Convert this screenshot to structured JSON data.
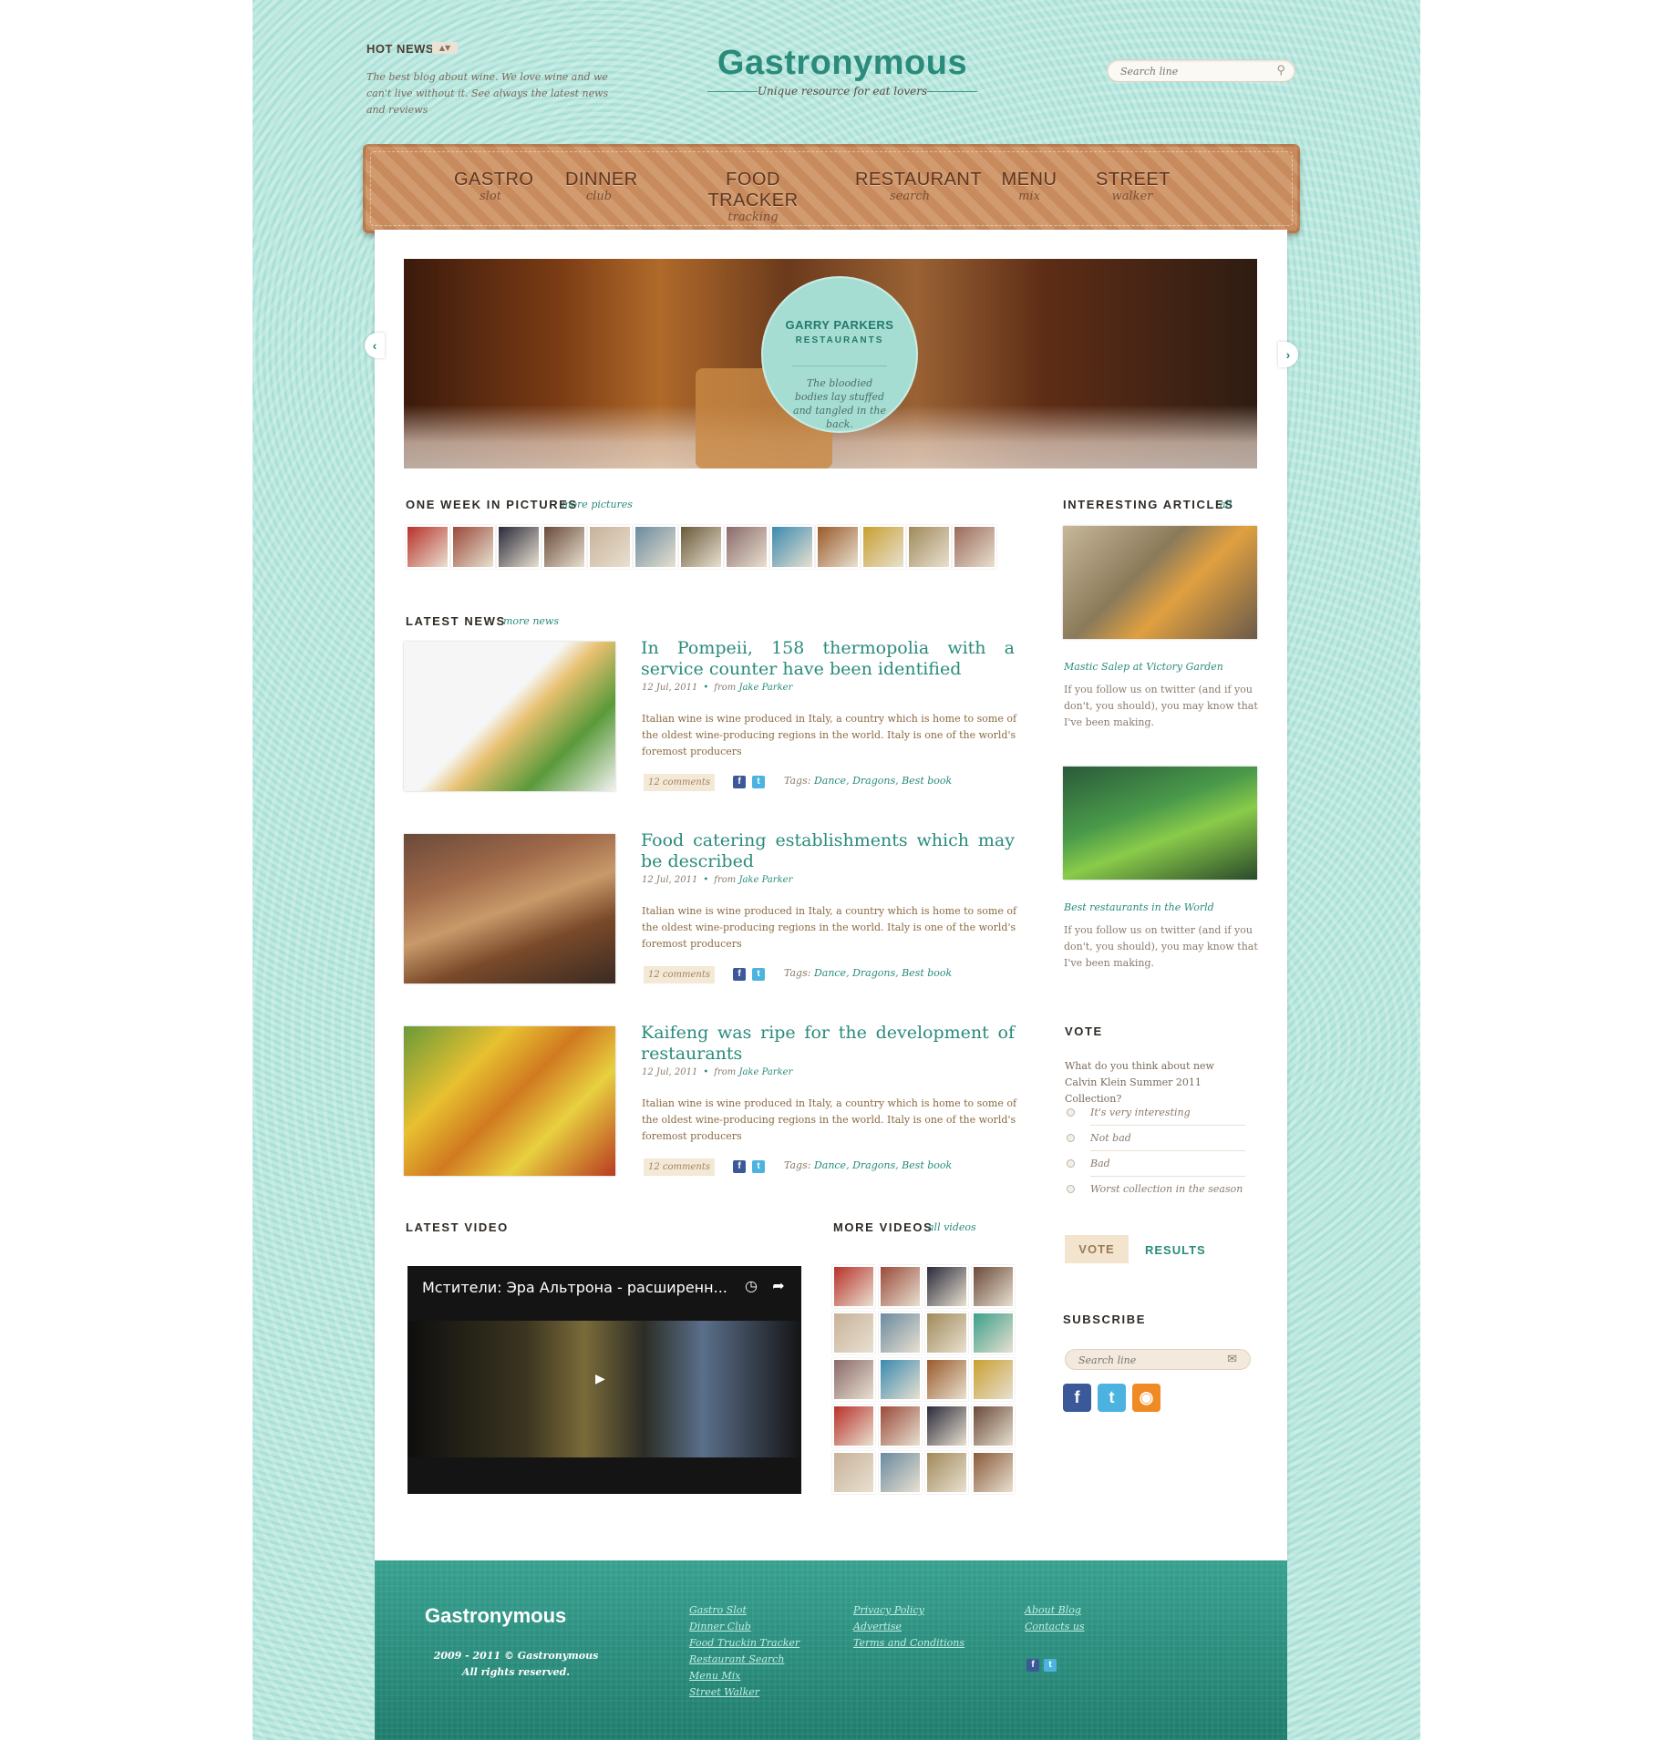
{
  "header": {
    "hot_news_title": "HOT NEWS",
    "hot_news_text": "The best blog about wine. We love wine and we can't live without it. See always the latest news and reviews",
    "logo": "Gastronymous",
    "tagline": "Unique resource for eat lovers",
    "search_placeholder": "Search line"
  },
  "nav": [
    {
      "title": "GASTRO",
      "sub": "slot"
    },
    {
      "title": "DINNER",
      "sub": "club"
    },
    {
      "title": "FOOD TRACKER",
      "sub": "tracking"
    },
    {
      "title": "RESTAURANT",
      "sub": "search"
    },
    {
      "title": "MENU",
      "sub": "mix"
    },
    {
      "title": "STREET",
      "sub": "walker"
    }
  ],
  "slider": {
    "title": "GARRY PARKERS",
    "subtitle": "RESTAURANTS",
    "text": "The bloodied bodies lay stuffed and tangled in the back."
  },
  "week_pictures": {
    "title": "ONE WEEK IN PICTURES",
    "link": "more pictures",
    "colors": [
      "#b8312a",
      "#9a4a3a",
      "#2a2a3a",
      "#6a4a3a",
      "#c8b29a",
      "#6a8aa0",
      "#6a5a3a",
      "#8a6a6a",
      "#3a8ab0",
      "#9a5a2a",
      "#c8a030",
      "#a08a5a",
      "#9a6a5a"
    ]
  },
  "latest_news": {
    "title": "LATEST NEWS",
    "link": "more news",
    "items": [
      {
        "title": "In Pompeii, 158 thermopolia with a service counter have been identified",
        "date": "12 Jul, 2011",
        "author_prefix": "from",
        "author": "Jake Parker",
        "text": "Italian wine is wine produced in Italy, a country which is home to some of the oldest wine-producing regions in the world. Italy is one of the world's foremost producers",
        "comments": "12 comments",
        "tags_label": "Tags:",
        "tags": "Dance, Dragons, Best book",
        "color": "#e8c070"
      },
      {
        "title": "Food catering establishments which may be described",
        "date": "12 Jul, 2011",
        "author_prefix": "from",
        "author": "Jake Parker",
        "text": "Italian wine is wine produced in Italy, a country which is home to some of the oldest wine-producing regions in the world. Italy is one of the world's foremost producers",
        "comments": "12 comments",
        "tags_label": "Tags:",
        "tags": "Dance, Dragons, Best book",
        "color": "#8a5a3a"
      },
      {
        "title": "Kaifeng was ripe for the development of restaurants",
        "date": "12 Jul, 2011",
        "author_prefix": "from",
        "author": "Jake Parker",
        "text": "Italian wine is wine produced in Italy, a country which is home to some of the oldest wine-producing regions in the world. Italy is one of the world's foremost producers",
        "comments": "12 comments",
        "tags_label": "Tags:",
        "tags": "Dance, Dragons, Best book",
        "color": "#e0a020"
      }
    ]
  },
  "sidebar": {
    "articles_title": "INTERESTING ARTICLES",
    "articles_link": "all",
    "articles": [
      {
        "title": "Mastic Salep at Victory Garden",
        "text": "If you follow us on twitter (and if you don't, you should), you may know that I've been making.",
        "color": "#8a7a5a"
      },
      {
        "title": "Best restaurants in the World",
        "text": "If you follow us on twitter (and if you don't, you should), you may know that I've been making.",
        "color": "#3a7a3a"
      }
    ],
    "vote": {
      "title": "VOTE",
      "question": "What do you think about new Calvin Klein Summer 2011 Collection?",
      "options": [
        "It's very interesting",
        "Not bad",
        "Bad",
        "Worst collection in the season"
      ],
      "vote_button": "VOTE",
      "results_button": "RESULTS"
    },
    "subscribe": {
      "title": "SUBSCRIBE",
      "placeholder": "Search line"
    }
  },
  "latest_video": {
    "title": "LATEST VIDEO",
    "video_title": "Мстители: Эра Альтрона - расширенн..."
  },
  "more_videos": {
    "title": "MORE VIDEOS",
    "link": "all videos",
    "colors": [
      "#b8312a",
      "#9a4a3a",
      "#2a2a3a",
      "#6a4a3a",
      "#c8b29a",
      "#6a8aa0",
      "#a08a5a",
      "#3aa08a",
      "#8a6a6a",
      "#3a8ab0",
      "#9a5a2a",
      "#c8a030",
      "#b8312a",
      "#9a4a3a",
      "#2a2a3a",
      "#6a4a3a",
      "#c8b29a",
      "#6a8aa0",
      "#a08a5a",
      "#8a5a3a"
    ]
  },
  "footer": {
    "logo": "Gastronymous",
    "copyright": "2009 - 2011 © Gastronymous",
    "rights": "All rights reserved.",
    "col1": [
      "Gastro Slot",
      "Dinner Club",
      "Food Truckin Tracker",
      "Restaurant Search",
      "Menu Mix",
      "Street Walker"
    ],
    "col2": [
      "Privacy Policy",
      "Advertise",
      "Terms and Conditions"
    ],
    "col3": [
      "About Blog",
      "Contacts us"
    ]
  }
}
